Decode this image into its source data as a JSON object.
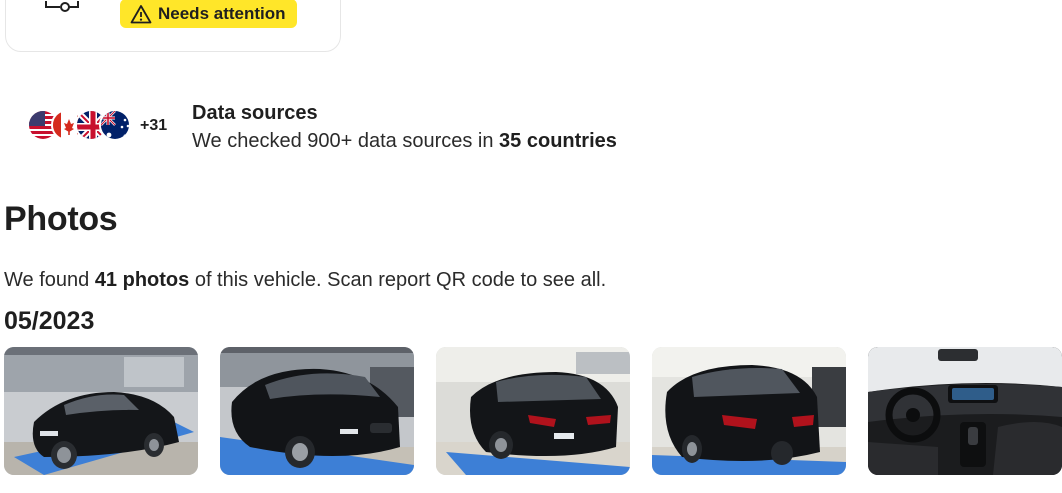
{
  "status_card": {
    "badge_label": "Needs attention",
    "icons": [
      "car-icon",
      "warning-icon"
    ]
  },
  "data_sources": {
    "flags": [
      "us-flag",
      "ca-flag",
      "uk-flag",
      "au-flag"
    ],
    "more_count": "+31",
    "title": "Data sources",
    "desc_prefix": "We checked 900+ data sources in ",
    "desc_bold": "35 countries"
  },
  "photos": {
    "heading": "Photos",
    "desc_prefix": "We found ",
    "desc_bold": "41 photos",
    "desc_suffix": " of this vehicle. Scan report QR code to see all.",
    "date": "05/2023",
    "thumbnails": [
      {
        "view": "front-three-quarter"
      },
      {
        "view": "front-three-quarter-close"
      },
      {
        "view": "rear-three-quarter"
      },
      {
        "view": "rear-three-quarter-close"
      },
      {
        "view": "interior-dashboard"
      }
    ]
  },
  "colors": {
    "badge_yellow": "#ffe629",
    "text_primary": "#1f1f1f",
    "lift_blue": "#3d7fd6"
  }
}
